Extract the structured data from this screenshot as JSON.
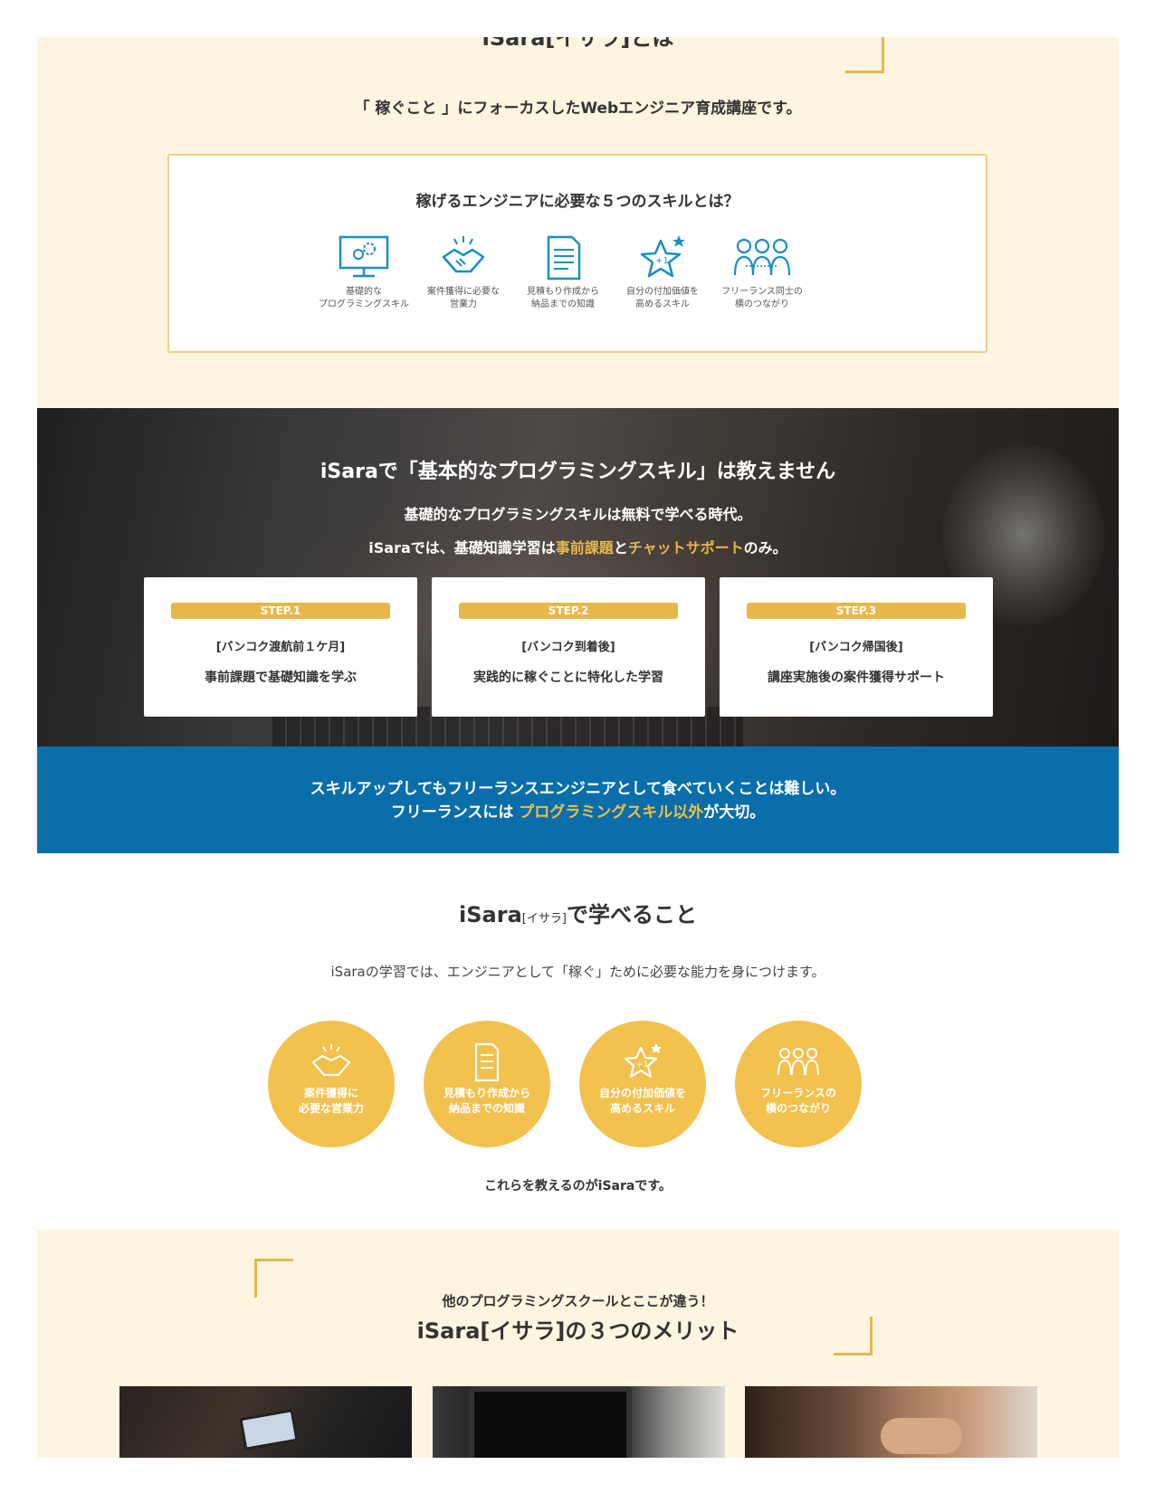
{
  "intro": {
    "title": "iSara[イサラ]とは",
    "lead": "「 稼ぐこと 」にフォーカスしたWebエンジニア育成講座です。",
    "box_title": "稼げるエンジニアに必要な５つのスキルとは？",
    "skills": [
      {
        "icon": "monitor-gears-icon",
        "caption": "基礎的な\nプログラミングスキル"
      },
      {
        "icon": "handshake-icon",
        "caption": "案件獲得に必要な\n営業力"
      },
      {
        "icon": "document-icon",
        "caption": "見積もり作成から\n納品までの知識"
      },
      {
        "icon": "star-plus-one-icon",
        "caption": "自分の付加価値を\n高めるスキル"
      },
      {
        "icon": "people-network-icon",
        "caption": "フリーランス同士の\n横のつながり"
      }
    ],
    "accent_color": "#e6b84c"
  },
  "photo_section": {
    "title": "iSaraで「基本的なプログラミングスキル」は教えません",
    "sub1": "基礎的なプログラミングスキルは無料で学べる時代。",
    "sub2_pre": "iSaraでは、基礎知識学習は",
    "sub2_hl1": "事前課題",
    "sub2_mid": "と",
    "sub2_hl2": "チャットサポート",
    "sub2_post": "のみ。",
    "steps": [
      {
        "badge": "STEP.1",
        "when": "[バンコク渡航前１ケ月]",
        "what": "事前課題で基礎知識を学ぶ"
      },
      {
        "badge": "STEP.2",
        "when": "[バンコク到着後]",
        "what": "実践的に稼ぐことに特化した学習"
      },
      {
        "badge": "STEP.3",
        "when": "[バンコク帰国後]",
        "what": "講座実施後の案件獲得サポート"
      }
    ]
  },
  "blue_band": {
    "line1": "スキルアップしてもフリーランスエンジニアとして食べていくことは難しい。",
    "line2_pre": "フリーランスには ",
    "line2_hl": "プログラミングスキル以外",
    "line2_post": "が大切。",
    "bg_color": "#0a6eaa"
  },
  "learn": {
    "title_pre": "iSara",
    "title_small": "[イサラ]",
    "title_post": "で学べること",
    "subtitle": "iSaraの学習では、エンジニアとして「稼ぐ」ために必要な能力を身につけます。",
    "circles": [
      {
        "icon": "handshake-icon",
        "text": "案件獲得に\n必要な営業力"
      },
      {
        "icon": "document-icon",
        "text": "見積もり作成から\n納品までの知識"
      },
      {
        "icon": "star-plus-one-icon",
        "text": "自分の付加価値を\n高めるスキル"
      },
      {
        "icon": "people-network-icon",
        "text": "フリーランスの\n横のつながり"
      }
    ],
    "closing": "これらを教えるのがiSaraです。",
    "circle_color": "#f2c14e"
  },
  "merits": {
    "kicker": "他のプログラミングスクールとここが違う！",
    "title": "iSara[イサラ]の３つのメリット"
  }
}
